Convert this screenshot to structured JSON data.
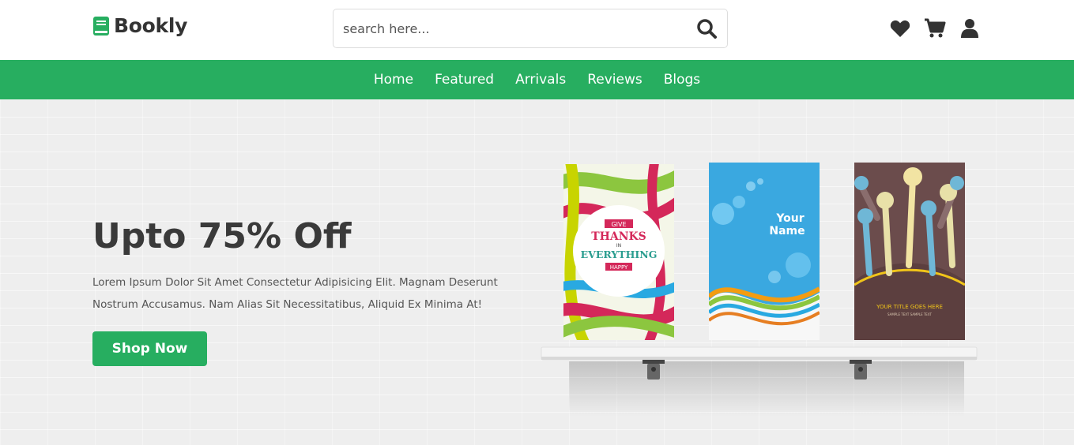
{
  "brand": {
    "name": "Bookly",
    "icon": "book-icon"
  },
  "search": {
    "placeholder": "search here...",
    "value": "",
    "icon": "search-icon"
  },
  "header_icons": [
    "heart-icon",
    "cart-icon",
    "user-icon"
  ],
  "nav": {
    "items": [
      "Home",
      "Featured",
      "Arrivals",
      "Reviews",
      "Blogs"
    ]
  },
  "hero": {
    "title": "Upto 75% Off",
    "text": "Lorem Ipsum Dolor Sit Amet Consectetur Adipisicing Elit. Magnam Deserunt Nostrum Accusamus. Nam Alias Sit Necessitatibus, Aliquid Ex Minima At!",
    "button": "Shop Now"
  },
  "books": [
    {
      "cover_lines": [
        "GIVE",
        "THANKS",
        "IN",
        "EVERYTHING",
        "HAPPY"
      ]
    },
    {
      "cover_lines": [
        "Your",
        "Name"
      ]
    },
    {
      "cover_lines": [
        "YOUR TITLE GOES HERE",
        "SAMPLE TEXT SAMPLE TEXT"
      ]
    }
  ],
  "colors": {
    "accent": "#27ae60",
    "text_dark": "#333333",
    "hero_bg": "#eeeeee"
  }
}
